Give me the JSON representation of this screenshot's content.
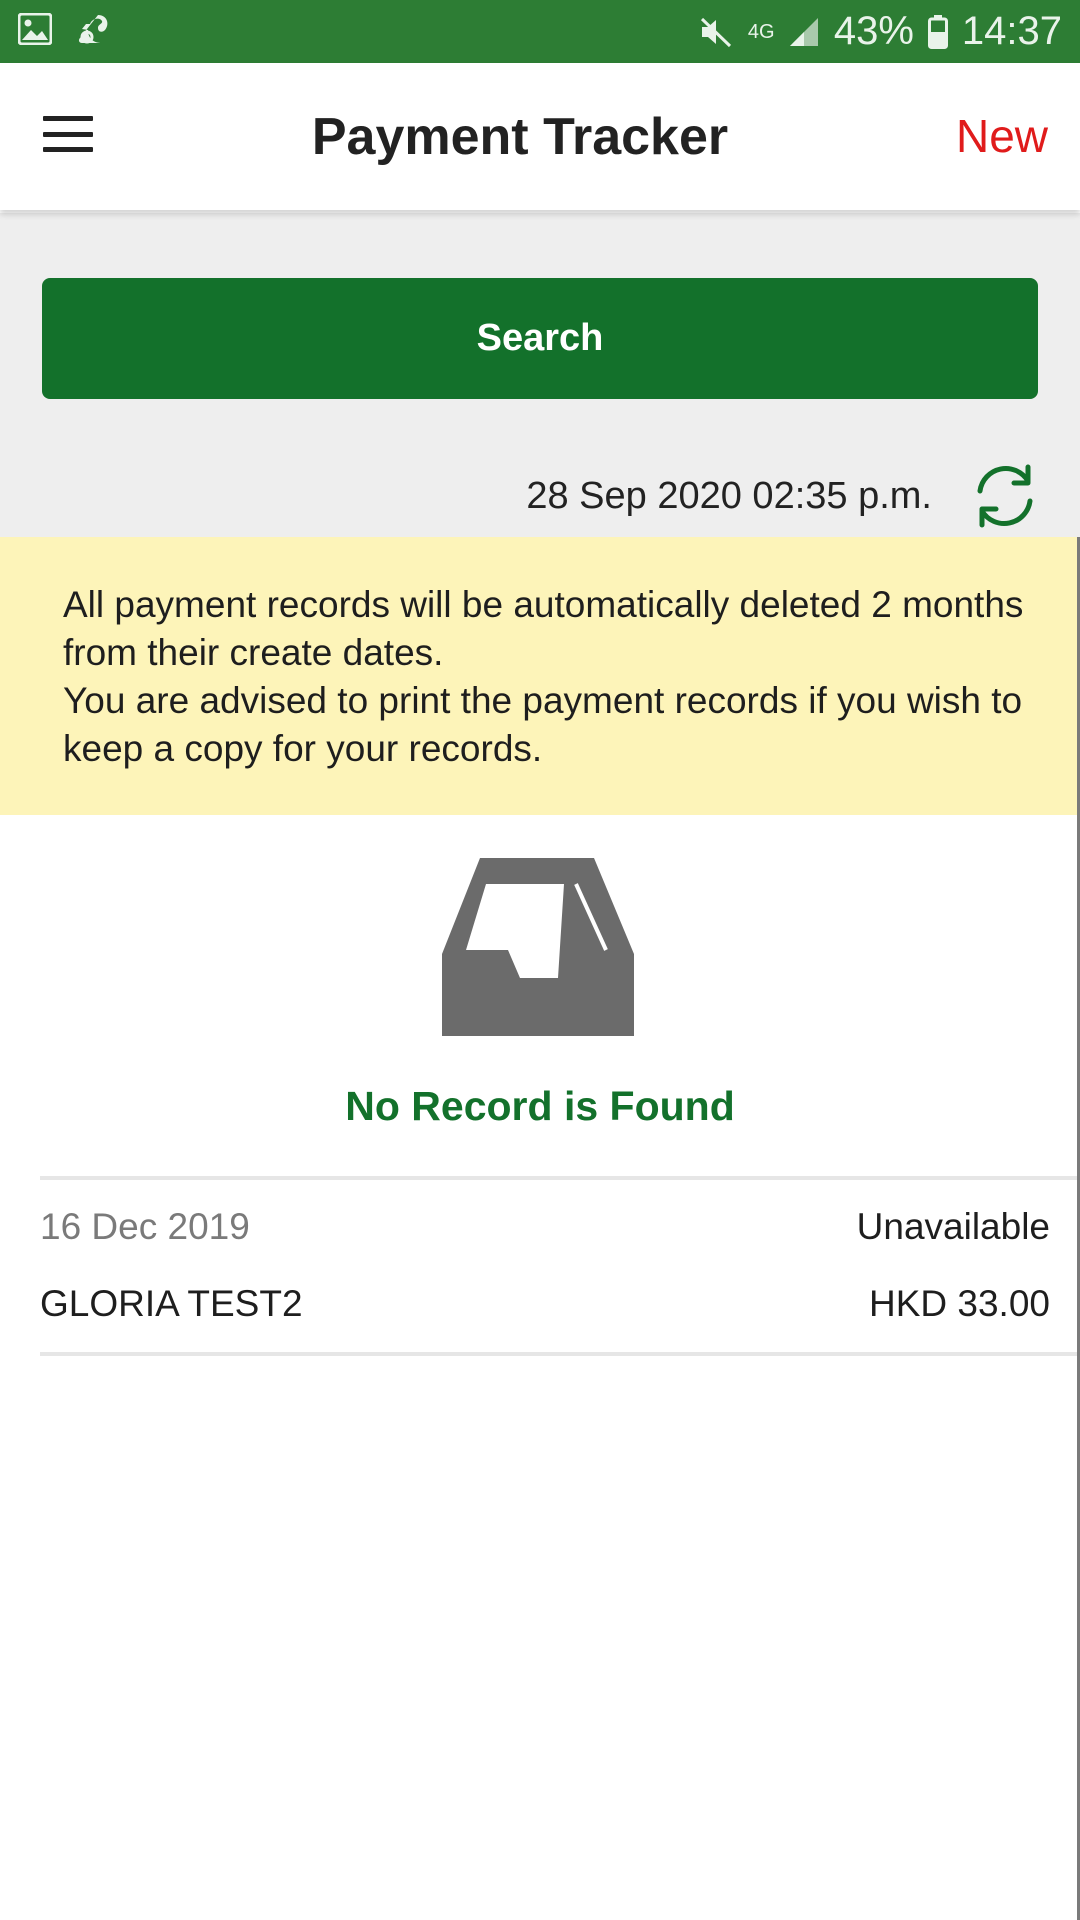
{
  "status_bar": {
    "battery": "43%",
    "time": "14:37",
    "network": "4G",
    "colors": {
      "background": "#2d7d34"
    }
  },
  "app_bar": {
    "title": "Payment Tracker",
    "new_label": "New",
    "menu_icon": "hamburger-menu-icon",
    "colors": {
      "new": "#e01b1b"
    }
  },
  "search": {
    "label": "Search",
    "colors": {
      "background": "#13712b"
    }
  },
  "last_updated": "28 Sep 2020 02:35 p.m.",
  "refresh_icon": "refresh-icon",
  "notice": {
    "line1": "All payment records will be automatically deleted 2 months from their create dates.",
    "line2": "You are advised to print the payment records if you wish to keep a copy for your records.",
    "colors": {
      "background": "#fdf4b9"
    }
  },
  "empty_state": {
    "icon": "empty-inbox-icon",
    "message": "No Record is Found",
    "colors": {
      "message": "#13712b",
      "icon": "#6b6b6b"
    }
  },
  "records": [
    {
      "date": "16 Dec 2019",
      "status": "Unavailable",
      "name": "GLORIA TEST2",
      "amount": "HKD 33.00"
    }
  ]
}
